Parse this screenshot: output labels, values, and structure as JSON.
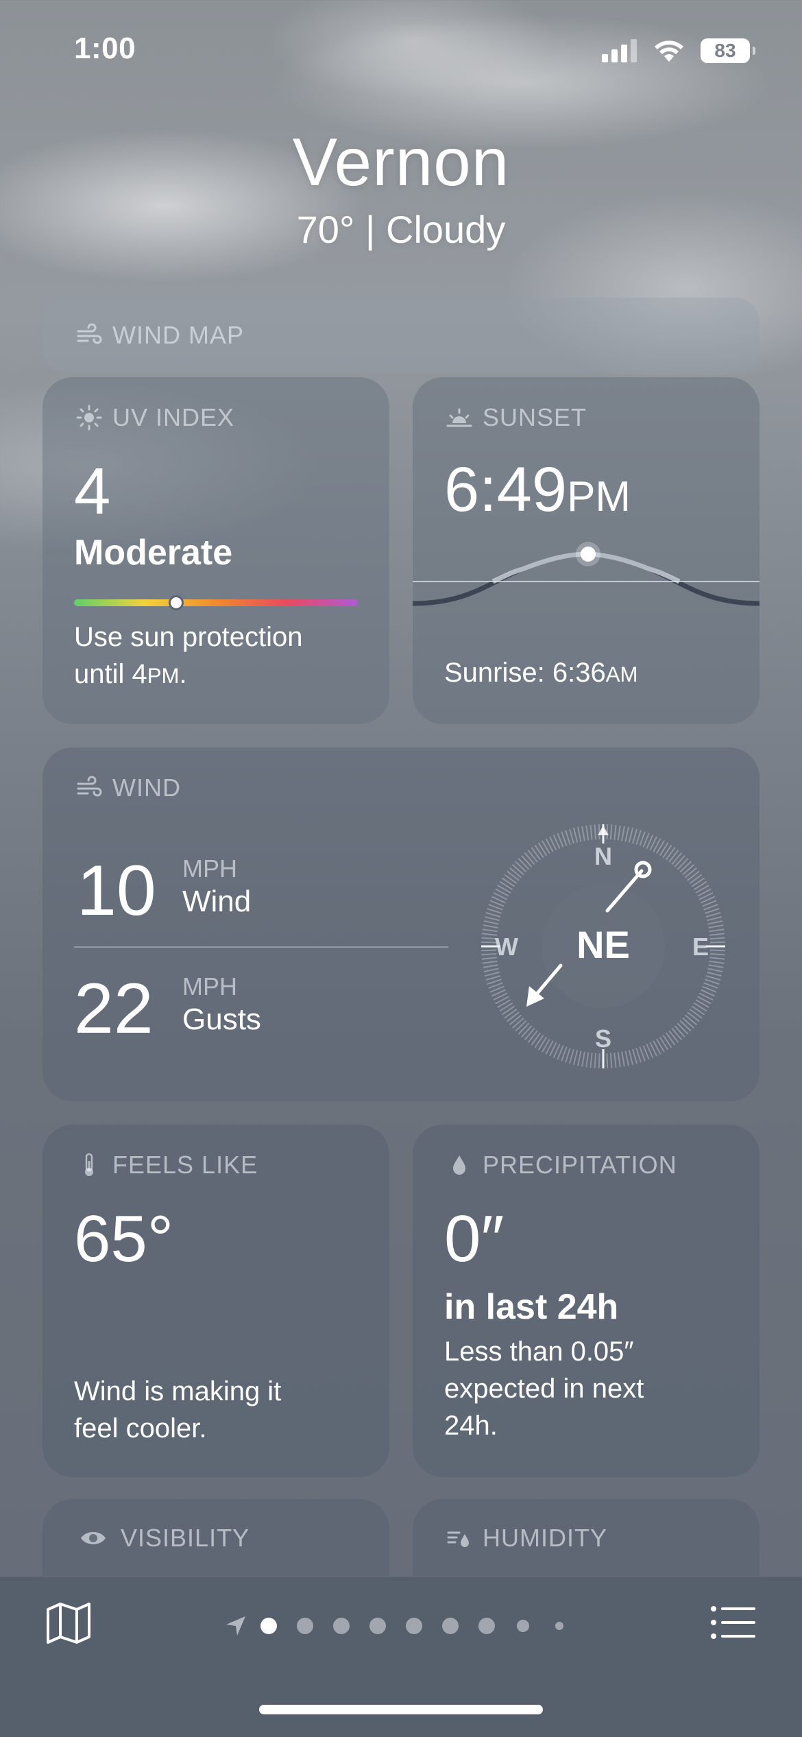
{
  "status_bar": {
    "time": "1:00",
    "battery": "83"
  },
  "location": {
    "city": "Vernon",
    "summary": "70°  |  Cloudy"
  },
  "wind_map": {
    "label": "WIND MAP"
  },
  "uv": {
    "label": "UV INDEX",
    "value": "4",
    "level": "Moderate",
    "scale_position": 0.36,
    "desc_line1": "Use sun protection",
    "desc_line2_prefix": "until 4",
    "desc_line2_suffix": "PM",
    "desc_line2_end": "."
  },
  "sunset": {
    "label": "SUNSET",
    "time": "6:49",
    "ampm": "PM",
    "sunrise_prefix": "Sunrise: 6:36",
    "sunrise_ampm": "AM"
  },
  "wind": {
    "label": "WIND",
    "speed": "10",
    "speed_unit": "MPH",
    "speed_label": "Wind",
    "gusts": "22",
    "gusts_unit": "MPH",
    "gusts_label": "Gusts",
    "direction": "NE",
    "compass": {
      "n": "N",
      "e": "E",
      "s": "S",
      "w": "W"
    }
  },
  "feels_like": {
    "label": "FEELS LIKE",
    "value": "65°",
    "desc_line1": "Wind is making it",
    "desc_line2": "feel cooler."
  },
  "precipitation": {
    "label": "PRECIPITATION",
    "value": "0″",
    "period": "in last 24h",
    "desc_line1": "Less than 0.05″",
    "desc_line2": "expected in next",
    "desc_line3": "24h."
  },
  "visibility": {
    "label": "VISIBILITY"
  },
  "humidity": {
    "label": "HUMIDITY"
  },
  "colors": {
    "uv_gradient": [
      "#5fd068",
      "#f3d23b",
      "#f08a2e",
      "#e84a5f",
      "#b05ad6"
    ]
  },
  "tabbar": {
    "map_icon": "map-icon",
    "list_icon": "list-icon",
    "page_count": 9,
    "active_page": 1
  }
}
